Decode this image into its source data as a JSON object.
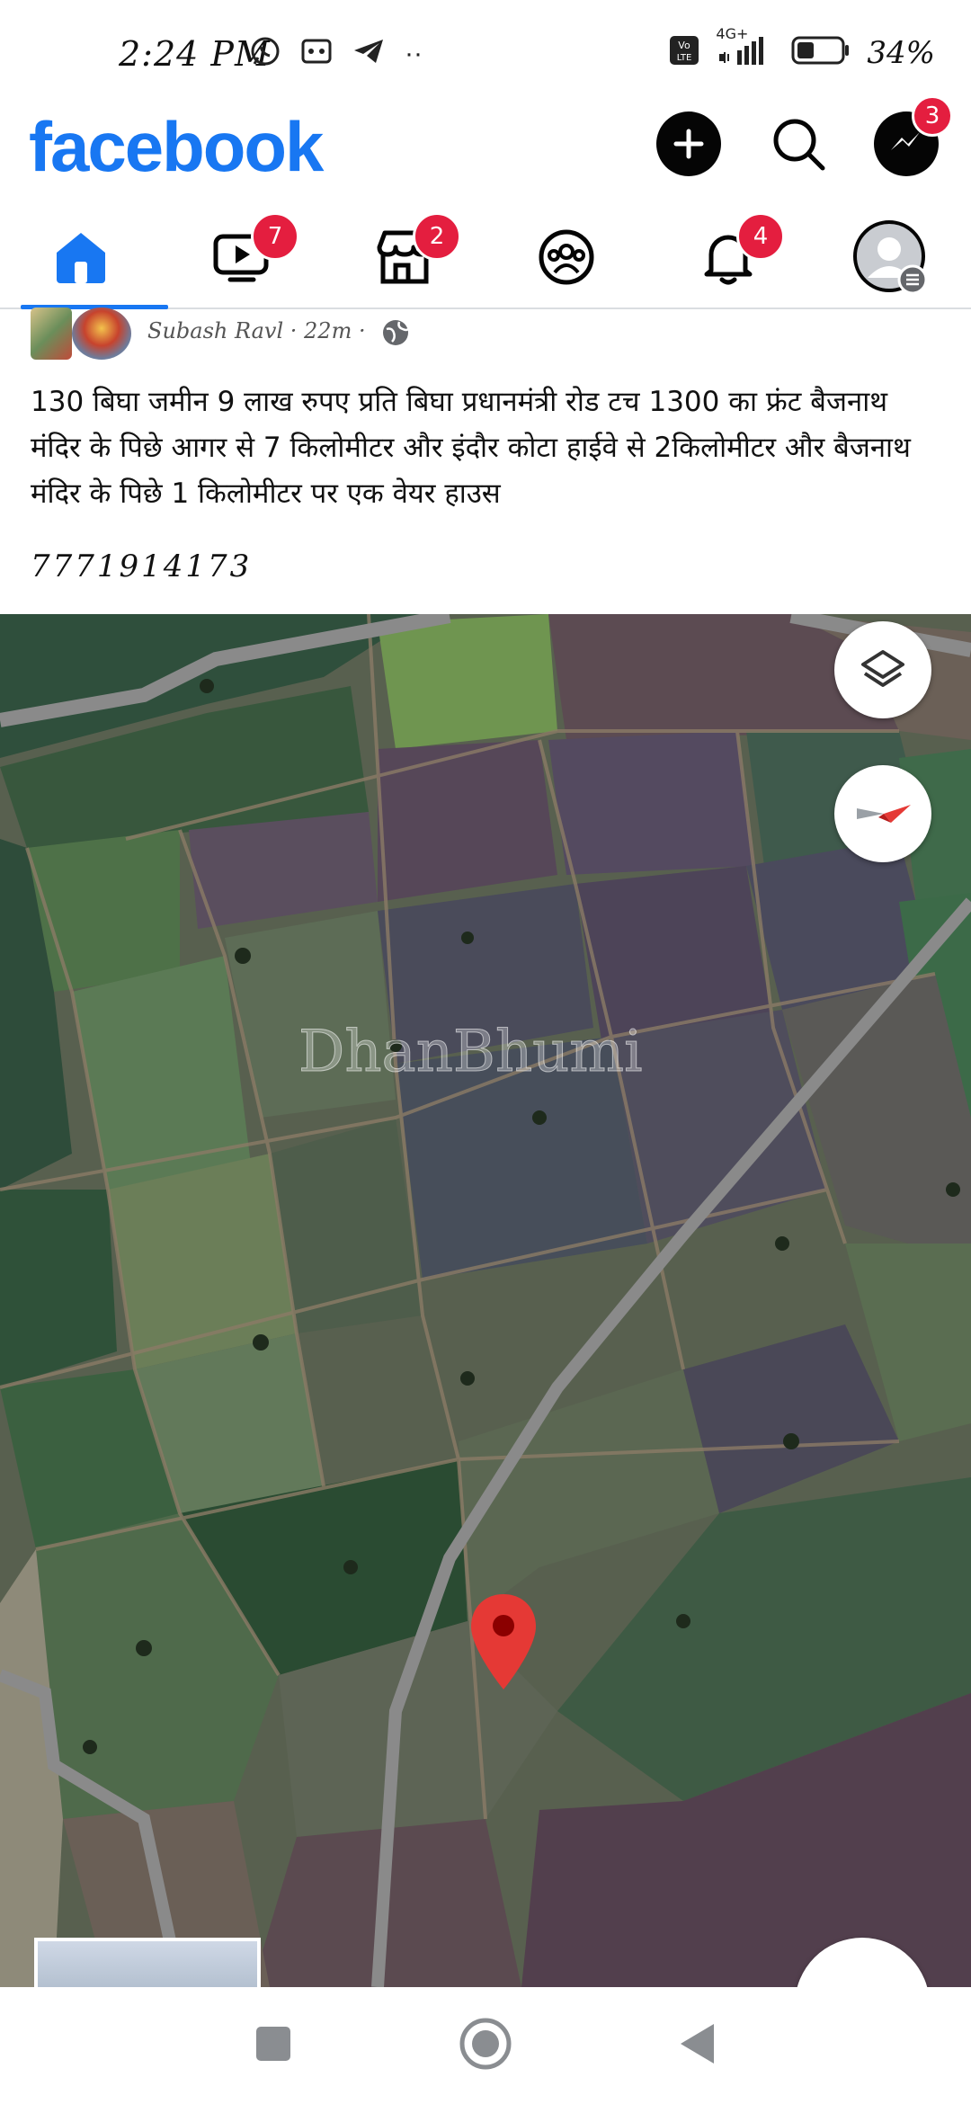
{
  "status_bar": {
    "time": "2:24 PM",
    "network": "4G+",
    "battery": "34%"
  },
  "header": {
    "logo": "facebook",
    "messenger_badge": "3"
  },
  "tabs": {
    "video_badge": "7",
    "marketplace_badge": "2",
    "notifications_badge": "4"
  },
  "post": {
    "author": "Subash Ravl",
    "time": "22m",
    "text": "130 बिघा जमीन 9 लाख रुपए प्रति बिघा प्रधानमंत्री रोड टच 1300 का फ्रंट बैजनाथ मंदिर के पिछे आगर से 7 किलोमीटर और इंदौर कोटा हाईवे से 2किलोमीटर और बैजनाथ मंदिर के पिछे 1 किलोमीटर पर एक वेयर हाउस",
    "phone": "7771914173"
  },
  "map": {
    "watermark": "DhanBhumi"
  },
  "colors": {
    "brand": "#1877f2",
    "badge": "#e41e3f",
    "pin": "#e53935"
  }
}
